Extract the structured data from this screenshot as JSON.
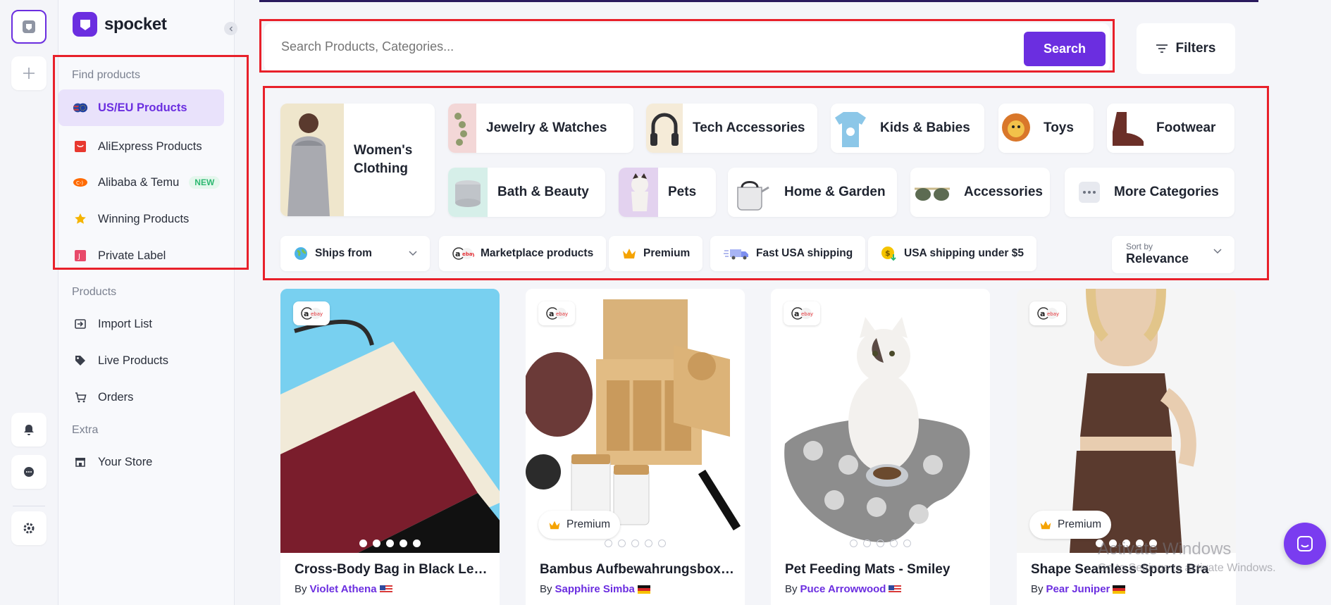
{
  "app": {
    "name": "spocket"
  },
  "sidebar": {
    "find_heading": "Find products",
    "find_items": [
      {
        "label": "US/EU Products",
        "icon": "us-eu-flag-icon",
        "active": true
      },
      {
        "label": "AliExpress Products",
        "icon": "aliexpress-icon"
      },
      {
        "label": "Alibaba & Temu",
        "icon": "alibaba-icon",
        "badge": "NEW"
      },
      {
        "label": "Winning Products",
        "icon": "star-icon"
      },
      {
        "label": "Private Label",
        "icon": "private-label-icon"
      }
    ],
    "products_heading": "Products",
    "product_items": [
      {
        "label": "Import List",
        "icon": "import-icon"
      },
      {
        "label": "Live Products",
        "icon": "tag-icon"
      },
      {
        "label": "Orders",
        "icon": "cart-icon"
      }
    ],
    "extra_heading": "Extra",
    "extra_items": [
      {
        "label": "Your Store",
        "icon": "store-icon"
      }
    ]
  },
  "search": {
    "placeholder": "Search Products, Categories...",
    "button": "Search",
    "filters": "Filters"
  },
  "categories": [
    {
      "label": "Women's Clothing"
    },
    {
      "label": "Jewelry & Watches"
    },
    {
      "label": "Tech Accessories"
    },
    {
      "label": "Kids & Babies"
    },
    {
      "label": "Toys"
    },
    {
      "label": "Footwear"
    },
    {
      "label": "Bath & Beauty"
    },
    {
      "label": "Pets"
    },
    {
      "label": "Home & Garden"
    },
    {
      "label": "Accessories"
    },
    {
      "label": "More Categories"
    }
  ],
  "filters": {
    "ships_from": "Ships from",
    "marketplace": "Marketplace products",
    "premium": "Premium",
    "fast_usa": "Fast USA shipping",
    "usa_under5": "USA shipping under $5",
    "sort_caption": "Sort by",
    "sort_value": "Relevance"
  },
  "products": [
    {
      "title": "Cross-Body Bag in Black Leath...",
      "by": "By",
      "supplier": "Violet Athena",
      "flag": "US",
      "premium": false
    },
    {
      "title": "Bambus Aufbewahrungsbox m...",
      "by": "By",
      "supplier": "Sapphire Simba",
      "flag": "DE",
      "premium": true,
      "premium_label": "Premium"
    },
    {
      "title": "Pet Feeding Mats - Smiley",
      "by": "By",
      "supplier": "Puce Arrowwood",
      "flag": "US",
      "premium": false
    },
    {
      "title": "Shape Seamless Sports Bra",
      "by": "By",
      "supplier": "Pear Juniper",
      "flag": "DE",
      "premium": true,
      "premium_label": "Premium"
    }
  ],
  "watermark": {
    "title": "Activate Windows",
    "subtitle": "Go to Settings to activate Windows."
  },
  "colors": {
    "accent": "#6b2ee0",
    "annotation": "#e8202a"
  }
}
